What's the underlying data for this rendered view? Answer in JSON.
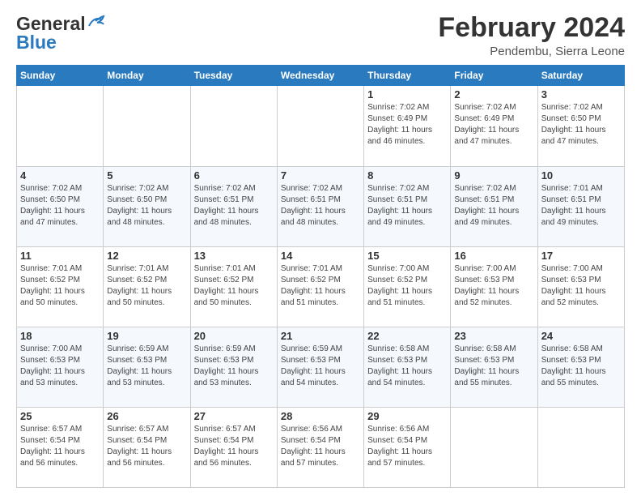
{
  "header": {
    "logo_line1": "General",
    "logo_line2": "Blue",
    "month_title": "February 2024",
    "location": "Pendembu, Sierra Leone"
  },
  "weekdays": [
    "Sunday",
    "Monday",
    "Tuesday",
    "Wednesday",
    "Thursday",
    "Friday",
    "Saturday"
  ],
  "weeks": [
    [
      {
        "day": "",
        "info": ""
      },
      {
        "day": "",
        "info": ""
      },
      {
        "day": "",
        "info": ""
      },
      {
        "day": "",
        "info": ""
      },
      {
        "day": "1",
        "info": "Sunrise: 7:02 AM\nSunset: 6:49 PM\nDaylight: 11 hours\nand 46 minutes."
      },
      {
        "day": "2",
        "info": "Sunrise: 7:02 AM\nSunset: 6:49 PM\nDaylight: 11 hours\nand 47 minutes."
      },
      {
        "day": "3",
        "info": "Sunrise: 7:02 AM\nSunset: 6:50 PM\nDaylight: 11 hours\nand 47 minutes."
      }
    ],
    [
      {
        "day": "4",
        "info": "Sunrise: 7:02 AM\nSunset: 6:50 PM\nDaylight: 11 hours\nand 47 minutes."
      },
      {
        "day": "5",
        "info": "Sunrise: 7:02 AM\nSunset: 6:50 PM\nDaylight: 11 hours\nand 48 minutes."
      },
      {
        "day": "6",
        "info": "Sunrise: 7:02 AM\nSunset: 6:51 PM\nDaylight: 11 hours\nand 48 minutes."
      },
      {
        "day": "7",
        "info": "Sunrise: 7:02 AM\nSunset: 6:51 PM\nDaylight: 11 hours\nand 48 minutes."
      },
      {
        "day": "8",
        "info": "Sunrise: 7:02 AM\nSunset: 6:51 PM\nDaylight: 11 hours\nand 49 minutes."
      },
      {
        "day": "9",
        "info": "Sunrise: 7:02 AM\nSunset: 6:51 PM\nDaylight: 11 hours\nand 49 minutes."
      },
      {
        "day": "10",
        "info": "Sunrise: 7:01 AM\nSunset: 6:51 PM\nDaylight: 11 hours\nand 49 minutes."
      }
    ],
    [
      {
        "day": "11",
        "info": "Sunrise: 7:01 AM\nSunset: 6:52 PM\nDaylight: 11 hours\nand 50 minutes."
      },
      {
        "day": "12",
        "info": "Sunrise: 7:01 AM\nSunset: 6:52 PM\nDaylight: 11 hours\nand 50 minutes."
      },
      {
        "day": "13",
        "info": "Sunrise: 7:01 AM\nSunset: 6:52 PM\nDaylight: 11 hours\nand 50 minutes."
      },
      {
        "day": "14",
        "info": "Sunrise: 7:01 AM\nSunset: 6:52 PM\nDaylight: 11 hours\nand 51 minutes."
      },
      {
        "day": "15",
        "info": "Sunrise: 7:00 AM\nSunset: 6:52 PM\nDaylight: 11 hours\nand 51 minutes."
      },
      {
        "day": "16",
        "info": "Sunrise: 7:00 AM\nSunset: 6:53 PM\nDaylight: 11 hours\nand 52 minutes."
      },
      {
        "day": "17",
        "info": "Sunrise: 7:00 AM\nSunset: 6:53 PM\nDaylight: 11 hours\nand 52 minutes."
      }
    ],
    [
      {
        "day": "18",
        "info": "Sunrise: 7:00 AM\nSunset: 6:53 PM\nDaylight: 11 hours\nand 53 minutes."
      },
      {
        "day": "19",
        "info": "Sunrise: 6:59 AM\nSunset: 6:53 PM\nDaylight: 11 hours\nand 53 minutes."
      },
      {
        "day": "20",
        "info": "Sunrise: 6:59 AM\nSunset: 6:53 PM\nDaylight: 11 hours\nand 53 minutes."
      },
      {
        "day": "21",
        "info": "Sunrise: 6:59 AM\nSunset: 6:53 PM\nDaylight: 11 hours\nand 54 minutes."
      },
      {
        "day": "22",
        "info": "Sunrise: 6:58 AM\nSunset: 6:53 PM\nDaylight: 11 hours\nand 54 minutes."
      },
      {
        "day": "23",
        "info": "Sunrise: 6:58 AM\nSunset: 6:53 PM\nDaylight: 11 hours\nand 55 minutes."
      },
      {
        "day": "24",
        "info": "Sunrise: 6:58 AM\nSunset: 6:53 PM\nDaylight: 11 hours\nand 55 minutes."
      }
    ],
    [
      {
        "day": "25",
        "info": "Sunrise: 6:57 AM\nSunset: 6:54 PM\nDaylight: 11 hours\nand 56 minutes."
      },
      {
        "day": "26",
        "info": "Sunrise: 6:57 AM\nSunset: 6:54 PM\nDaylight: 11 hours\nand 56 minutes."
      },
      {
        "day": "27",
        "info": "Sunrise: 6:57 AM\nSunset: 6:54 PM\nDaylight: 11 hours\nand 56 minutes."
      },
      {
        "day": "28",
        "info": "Sunrise: 6:56 AM\nSunset: 6:54 PM\nDaylight: 11 hours\nand 57 minutes."
      },
      {
        "day": "29",
        "info": "Sunrise: 6:56 AM\nSunset: 6:54 PM\nDaylight: 11 hours\nand 57 minutes."
      },
      {
        "day": "",
        "info": ""
      },
      {
        "day": "",
        "info": ""
      }
    ]
  ]
}
